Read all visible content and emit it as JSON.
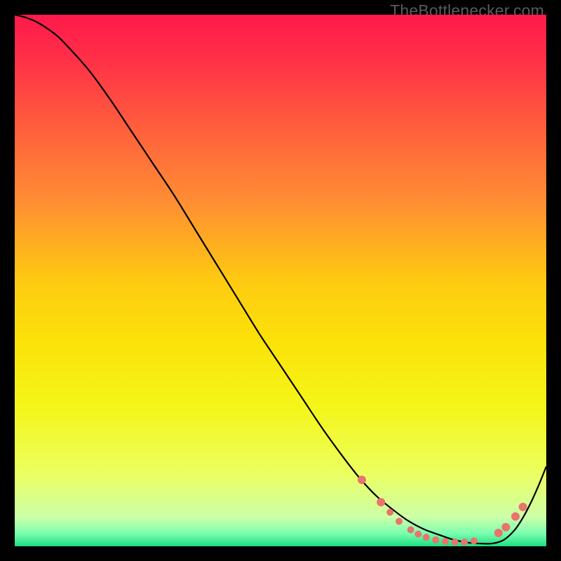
{
  "watermark": "TheBottlenecker.com",
  "chart_data": {
    "type": "line",
    "title": "",
    "xlabel": "",
    "ylabel": "",
    "xlim": [
      0,
      100
    ],
    "ylim": [
      0,
      100
    ],
    "background_gradient": [
      {
        "stop": 0.0,
        "color": "#ff1a4b"
      },
      {
        "stop": 0.07,
        "color": "#ff2b48"
      },
      {
        "stop": 0.2,
        "color": "#ff5a3e"
      },
      {
        "stop": 0.35,
        "color": "#ff8d33"
      },
      {
        "stop": 0.5,
        "color": "#feca11"
      },
      {
        "stop": 0.62,
        "color": "#fbe309"
      },
      {
        "stop": 0.74,
        "color": "#f4f61a"
      },
      {
        "stop": 0.86,
        "color": "#ecff5e"
      },
      {
        "stop": 0.945,
        "color": "#cdffa8"
      },
      {
        "stop": 0.975,
        "color": "#7dffb0"
      },
      {
        "stop": 1.0,
        "color": "#1dde82"
      }
    ],
    "series": [
      {
        "name": "curve",
        "stroke": "#000000",
        "x": [
          0,
          2,
          4,
          6,
          8,
          10,
          14,
          18,
          22,
          26,
          30,
          34,
          38,
          42,
          46,
          50,
          54,
          58,
          62,
          65,
          68,
          71,
          74,
          77,
          80,
          82,
          84,
          86,
          88,
          90,
          92,
          94,
          95.5,
          97,
          98.5,
          100
        ],
        "y": [
          100,
          99.5,
          98.7,
          97.5,
          96,
          94,
          89.5,
          84,
          78,
          72,
          66,
          59.5,
          53,
          46.5,
          40,
          34,
          28,
          22,
          16.5,
          12.7,
          9.5,
          7,
          4.8,
          3.2,
          2.1,
          1.4,
          0.9,
          0.6,
          0.5,
          0.55,
          1.2,
          3,
          5.2,
          8,
          11.3,
          15
        ]
      }
    ],
    "markers": {
      "name": "dots",
      "color": "#e9746c",
      "radius_default": 5,
      "points": [
        {
          "x": 65.3,
          "y": 12.5,
          "r": 6
        },
        {
          "x": 68.9,
          "y": 8.3,
          "r": 6
        },
        {
          "x": 70.6,
          "y": 6.4,
          "r": 5
        },
        {
          "x": 72.3,
          "y": 4.7,
          "r": 5
        },
        {
          "x": 74.5,
          "y": 3.1,
          "r": 5
        },
        {
          "x": 75.9,
          "y": 2.3,
          "r": 5
        },
        {
          "x": 77.4,
          "y": 1.7,
          "r": 5
        },
        {
          "x": 79.2,
          "y": 1.2,
          "r": 5
        },
        {
          "x": 81.0,
          "y": 0.9,
          "r": 5
        },
        {
          "x": 82.8,
          "y": 0.8,
          "r": 5
        },
        {
          "x": 84.6,
          "y": 0.8,
          "r": 5
        },
        {
          "x": 86.4,
          "y": 1.0,
          "r": 5
        },
        {
          "x": 91.0,
          "y": 2.5,
          "r": 6
        },
        {
          "x": 92.4,
          "y": 3.6,
          "r": 6
        },
        {
          "x": 94.2,
          "y": 5.6,
          "r": 6
        },
        {
          "x": 95.6,
          "y": 7.4,
          "r": 6
        }
      ]
    }
  }
}
